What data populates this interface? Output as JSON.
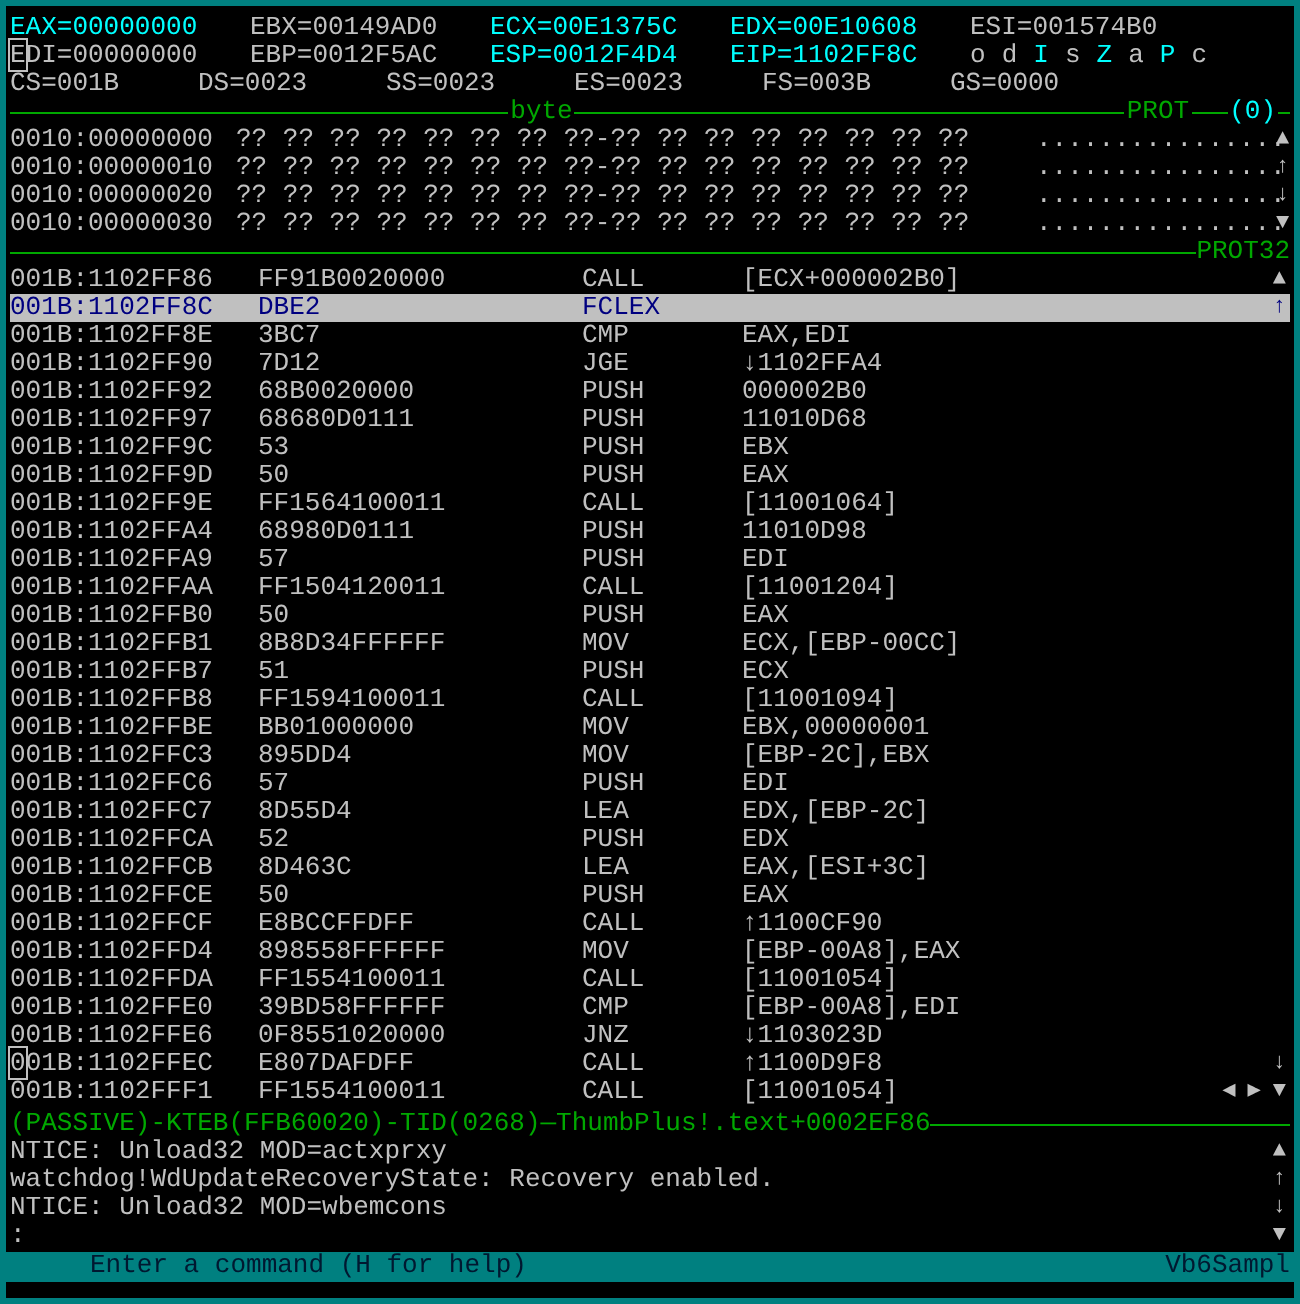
{
  "registers": [
    [
      {
        "text": "EAX=00000000",
        "changed": true,
        "cursor": false
      },
      {
        "text": "EBX=00149AD0",
        "changed": false,
        "cursor": false
      },
      {
        "text": "ECX=00E1375C",
        "changed": true,
        "cursor": false
      },
      {
        "text": "EDX=00E10608",
        "changed": true,
        "cursor": false
      },
      {
        "text": "ESI=001574B0",
        "changed": false,
        "cursor": false
      }
    ],
    [
      {
        "text": "EDI=00000000",
        "changed": false,
        "cursor": true
      },
      {
        "text": "EBP=0012F5AC",
        "changed": false,
        "cursor": false
      },
      {
        "text": "ESP=0012F4D4",
        "changed": true,
        "cursor": false
      },
      {
        "text": "EIP=1102FF8C",
        "changed": true,
        "cursor": false
      }
    ]
  ],
  "flags": [
    {
      "label": "o",
      "on": false
    },
    {
      "label": "d",
      "on": false
    },
    {
      "label": "I",
      "on": true
    },
    {
      "label": "s",
      "on": false
    },
    {
      "label": "Z",
      "on": true
    },
    {
      "label": "a",
      "on": false
    },
    {
      "label": "P",
      "on": true
    },
    {
      "label": "c",
      "on": false
    }
  ],
  "segments": [
    "CS=001B",
    "DS=0023",
    "SS=0023",
    "ES=0023",
    "FS=003B",
    "GS=0000"
  ],
  "data_pane": {
    "format": "byte",
    "mode": "PROT",
    "index": "(0)",
    "rows": [
      {
        "address": "0010:00000000",
        "bytes": "?? ?? ?? ?? ?? ?? ?? ??-?? ?? ?? ?? ?? ?? ?? ??",
        "ascii": "................",
        "mark": "▲"
      },
      {
        "address": "0010:00000010",
        "bytes": "?? ?? ?? ?? ?? ?? ?? ??-?? ?? ?? ?? ?? ?? ?? ??",
        "ascii": "................",
        "mark": "↑"
      },
      {
        "address": "0010:00000020",
        "bytes": "?? ?? ?? ?? ?? ?? ?? ??-?? ?? ?? ?? ?? ?? ?? ??",
        "ascii": "................",
        "mark": "↓"
      },
      {
        "address": "0010:00000030",
        "bytes": "?? ?? ?? ?? ?? ?? ?? ??-?? ?? ?? ?? ?? ?? ?? ??",
        "ascii": "................",
        "mark": "▼"
      }
    ]
  },
  "code_pane": {
    "mode": "PROT32",
    "rows": [
      {
        "address": "001B:1102FF86",
        "bytes": "FF91B0020000",
        "mnemonic": "CALL",
        "operands": "[ECX+000002B0]",
        "selected": false,
        "cursor": false,
        "marks": [
          "▲"
        ]
      },
      {
        "address": "001B:1102FF8C",
        "bytes": "DBE2",
        "mnemonic": "FCLEX",
        "operands": "",
        "selected": true,
        "cursor": false,
        "marks": [
          "↑"
        ]
      },
      {
        "address": "001B:1102FF8E",
        "bytes": "3BC7",
        "mnemonic": "CMP",
        "operands": "EAX,EDI",
        "selected": false,
        "cursor": false
      },
      {
        "address": "001B:1102FF90",
        "bytes": "7D12",
        "mnemonic": "JGE",
        "operands": "↓1102FFA4",
        "selected": false,
        "cursor": false
      },
      {
        "address": "001B:1102FF92",
        "bytes": "68B0020000",
        "mnemonic": "PUSH",
        "operands": "000002B0",
        "selected": false,
        "cursor": false
      },
      {
        "address": "001B:1102FF97",
        "bytes": "68680D0111",
        "mnemonic": "PUSH",
        "operands": "11010D68",
        "selected": false,
        "cursor": false
      },
      {
        "address": "001B:1102FF9C",
        "bytes": "53",
        "mnemonic": "PUSH",
        "operands": "EBX",
        "selected": false,
        "cursor": false
      },
      {
        "address": "001B:1102FF9D",
        "bytes": "50",
        "mnemonic": "PUSH",
        "operands": "EAX",
        "selected": false,
        "cursor": false
      },
      {
        "address": "001B:1102FF9E",
        "bytes": "FF1564100011",
        "mnemonic": "CALL",
        "operands": "[11001064]",
        "selected": false,
        "cursor": false
      },
      {
        "address": "001B:1102FFA4",
        "bytes": "68980D0111",
        "mnemonic": "PUSH",
        "operands": "11010D98",
        "selected": false,
        "cursor": false
      },
      {
        "address": "001B:1102FFA9",
        "bytes": "57",
        "mnemonic": "PUSH",
        "operands": "EDI",
        "selected": false,
        "cursor": false
      },
      {
        "address": "001B:1102FFAA",
        "bytes": "FF1504120011",
        "mnemonic": "CALL",
        "operands": "[11001204]",
        "selected": false,
        "cursor": false
      },
      {
        "address": "001B:1102FFB0",
        "bytes": "50",
        "mnemonic": "PUSH",
        "operands": "EAX",
        "selected": false,
        "cursor": false
      },
      {
        "address": "001B:1102FFB1",
        "bytes": "8B8D34FFFFFF",
        "mnemonic": "MOV",
        "operands": "ECX,[EBP-00CC]",
        "selected": false,
        "cursor": false
      },
      {
        "address": "001B:1102FFB7",
        "bytes": "51",
        "mnemonic": "PUSH",
        "operands": "ECX",
        "selected": false,
        "cursor": false
      },
      {
        "address": "001B:1102FFB8",
        "bytes": "FF1594100011",
        "mnemonic": "CALL",
        "operands": "[11001094]",
        "selected": false,
        "cursor": false
      },
      {
        "address": "001B:1102FFBE",
        "bytes": "BB01000000",
        "mnemonic": "MOV",
        "operands": "EBX,00000001",
        "selected": false,
        "cursor": false
      },
      {
        "address": "001B:1102FFC3",
        "bytes": "895DD4",
        "mnemonic": "MOV",
        "operands": "[EBP-2C],EBX",
        "selected": false,
        "cursor": false
      },
      {
        "address": "001B:1102FFC6",
        "bytes": "57",
        "mnemonic": "PUSH",
        "operands": "EDI",
        "selected": false,
        "cursor": false
      },
      {
        "address": "001B:1102FFC7",
        "bytes": "8D55D4",
        "mnemonic": "LEA",
        "operands": "EDX,[EBP-2C]",
        "selected": false,
        "cursor": false
      },
      {
        "address": "001B:1102FFCA",
        "bytes": "52",
        "mnemonic": "PUSH",
        "operands": "EDX",
        "selected": false,
        "cursor": false
      },
      {
        "address": "001B:1102FFCB",
        "bytes": "8D463C",
        "mnemonic": "LEA",
        "operands": "EAX,[ESI+3C]",
        "selected": false,
        "cursor": false
      },
      {
        "address": "001B:1102FFCE",
        "bytes": "50",
        "mnemonic": "PUSH",
        "operands": "EAX",
        "selected": false,
        "cursor": false
      },
      {
        "address": "001B:1102FFCF",
        "bytes": "E8BCCFFDFF",
        "mnemonic": "CALL",
        "operands": "↑1100CF90",
        "selected": false,
        "cursor": false
      },
      {
        "address": "001B:1102FFD4",
        "bytes": "898558FFFFFF",
        "mnemonic": "MOV",
        "operands": "[EBP-00A8],EAX",
        "selected": false,
        "cursor": false
      },
      {
        "address": "001B:1102FFDA",
        "bytes": "FF1554100011",
        "mnemonic": "CALL",
        "operands": "[11001054]",
        "selected": false,
        "cursor": false
      },
      {
        "address": "001B:1102FFE0",
        "bytes": "39BD58FFFFFF",
        "mnemonic": "CMP",
        "operands": "[EBP-00A8],EDI",
        "selected": false,
        "cursor": false
      },
      {
        "address": "001B:1102FFE6",
        "bytes": "0F8551020000",
        "mnemonic": "JNZ",
        "operands": "↓1103023D",
        "selected": false,
        "cursor": false
      },
      {
        "address": "001B:1102FFEC",
        "bytes": "E807DAFDFF",
        "mnemonic": "CALL",
        "operands": "↑1100D9F8",
        "selected": false,
        "cursor": true,
        "marks": [
          "↓"
        ]
      },
      {
        "address": "001B:1102FFF1",
        "bytes": "FF1554100011",
        "mnemonic": "CALL",
        "operands": "[11001054]",
        "selected": false,
        "cursor": false,
        "marks": [
          "◀",
          "▶",
          "▼"
        ]
      }
    ]
  },
  "status_line": "(PASSIVE)-KTEB(FFB60020)-TID(0268)—ThumbPlus!.text+0002EF86",
  "log": [
    {
      "text": "NTICE: Unload32 MOD=actxprxy",
      "mark": "▲"
    },
    {
      "text": "watchdog!WdUpdateRecoveryState: Recovery enabled.",
      "mark": "↑"
    },
    {
      "text": "NTICE: Unload32 MOD=wbemcons",
      "mark": "↓"
    },
    {
      "text": ":",
      "mark": "▼"
    }
  ],
  "command_bar": {
    "hint": "Enter a command (H for help)",
    "module": "Vb6Sampl"
  }
}
